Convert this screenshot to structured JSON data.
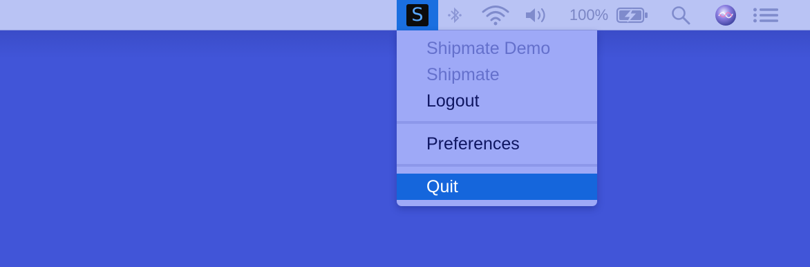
{
  "menubar": {
    "app_icon_letter": "S",
    "battery_percent": "100%",
    "icons": [
      "bluetooth-icon",
      "wifi-icon",
      "volume-icon",
      "battery-charging-icon",
      "spotlight-search-icon",
      "siri-icon",
      "notification-center-icon"
    ]
  },
  "menu": {
    "items": [
      {
        "label": "Shipmate Demo",
        "enabled": false
      },
      {
        "label": "Shipmate",
        "enabled": false
      },
      {
        "label": "Logout",
        "enabled": true
      },
      {
        "label": "Preferences",
        "enabled": true
      },
      {
        "label": "Quit",
        "enabled": true,
        "highlighted": true
      }
    ]
  },
  "colors": {
    "desktop": "#4155d8",
    "menubar": "#b9c3f4",
    "menu_bg": "#9ea9f7",
    "highlight": "#1566dc",
    "app_icon_letter": "#5aa9ff"
  }
}
